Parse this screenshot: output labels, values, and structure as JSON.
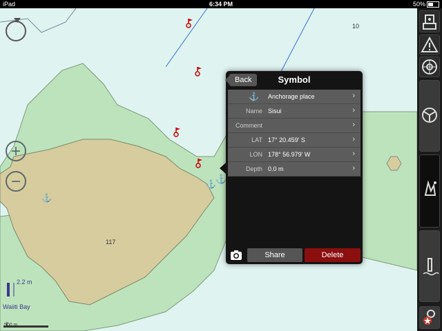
{
  "statusbar": {
    "carrier": "iPad",
    "time": "6:34 PM",
    "battery": "50%"
  },
  "map": {
    "depth_labels": [
      "10",
      "117"
    ],
    "scale_label": "500 m",
    "tide_label": "2.2 m",
    "place_name": "Waiiti Bay"
  },
  "popup": {
    "back_label": "Back",
    "title": "Symbol",
    "rows": [
      {
        "label": "",
        "value": "Anchorage place",
        "icon": "anchor-icon"
      },
      {
        "label": "Name",
        "value": "Sisui"
      },
      {
        "label": "Comment",
        "value": ""
      },
      {
        "label": "LAT",
        "value": "17° 20.459' S"
      },
      {
        "label": "LON",
        "value": "178° 56.979' W"
      },
      {
        "label": "Depth",
        "value": "0.0 m"
      }
    ],
    "share_label": "Share",
    "delete_label": "Delete"
  },
  "sidebar": {
    "buttons": [
      "settings-robot-icon",
      "warning-icon",
      "helm-wheel-icon",
      "steering-wheel-icon",
      "waypoint-gesture-icon",
      "tide-gauge-icon",
      "settings-gears-icon"
    ]
  },
  "colors": {
    "land": "#d6cc9e",
    "shallow": "#bde3bd",
    "water": "#dff3f0",
    "delete": "#8b0f0f"
  }
}
